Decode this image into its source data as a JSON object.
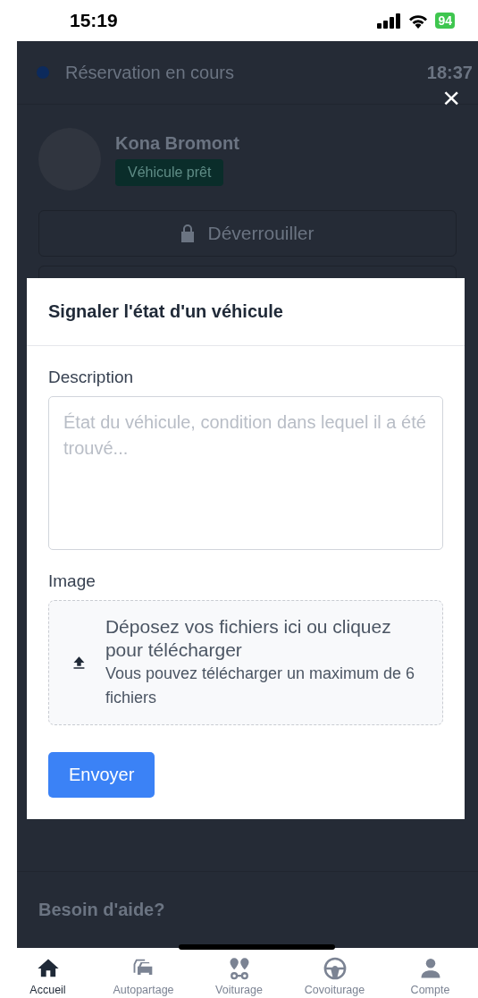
{
  "status_bar": {
    "time": "15:19",
    "battery": "94"
  },
  "background": {
    "reservation": {
      "label": "Réservation en cours",
      "time": "18:37"
    },
    "vehicle": {
      "name": "Kona Bromont",
      "status": "Véhicule prêt"
    },
    "unlock_button": "Déverrouiller",
    "help_title": "Besoin d'aide?"
  },
  "close_button": "×",
  "modal": {
    "title": "Signaler l'état d'un véhicule",
    "description": {
      "label": "Description",
      "placeholder": "État du véhicule, condition dans lequel il a été trouvé..."
    },
    "image": {
      "label": "Image",
      "dropzone_title": "Déposez vos fichiers ici ou cliquez pour télécharger",
      "dropzone_hint": "Vous pouvez télécharger un maximum de 6 fichiers"
    },
    "submit": "Envoyer"
  },
  "tab_bar": [
    {
      "label": "Accueil",
      "kind": "home",
      "selected": true
    },
    {
      "label": "Autopartage",
      "kind": "car",
      "selected": false
    },
    {
      "label": "Voiturage",
      "kind": "route",
      "selected": false
    },
    {
      "label": "Covoiturage",
      "kind": "wheel",
      "selected": false
    },
    {
      "label": "Compte",
      "kind": "person",
      "selected": false
    }
  ]
}
